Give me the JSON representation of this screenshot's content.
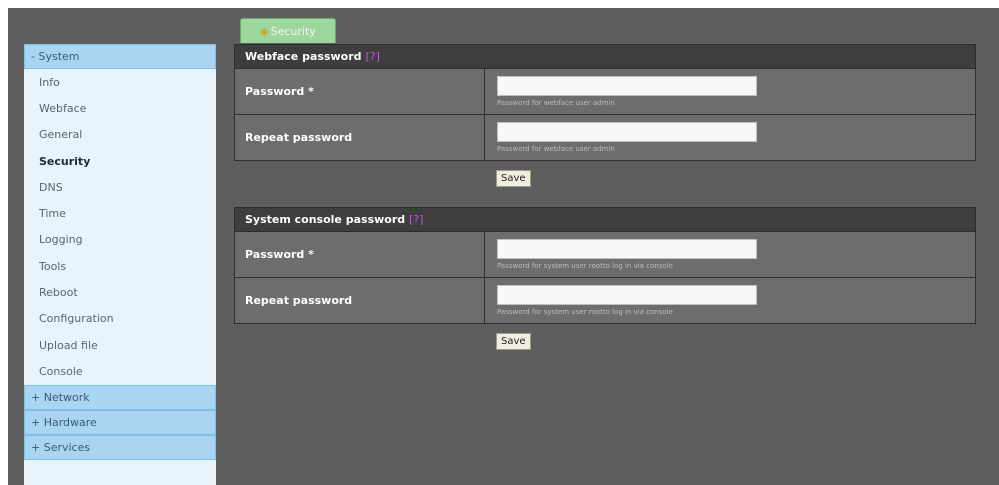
{
  "tab": {
    "label": "Security",
    "icon": "key-icon"
  },
  "sidebar": {
    "system_header": "- System",
    "items": [
      {
        "label": "Info"
      },
      {
        "label": "Webface"
      },
      {
        "label": "General"
      },
      {
        "label": "Security",
        "active": true
      },
      {
        "label": "DNS"
      },
      {
        "label": "Time"
      },
      {
        "label": "Logging"
      },
      {
        "label": "Tools"
      },
      {
        "label": "Reboot"
      },
      {
        "label": "Configuration"
      },
      {
        "label": "Upload file"
      },
      {
        "label": "Console"
      }
    ],
    "network_header": "+ Network",
    "hardware_header": "+ Hardware",
    "services_header": "+ Services"
  },
  "webface_section": {
    "title": "Webface password",
    "help": "[?]",
    "password_label": "Password *",
    "password_hint": "Password for webface user admin",
    "repeat_label": "Repeat password",
    "repeat_hint": "Password for webface user admin",
    "save_label": "Save"
  },
  "console_section": {
    "title": "System console password",
    "help": "[?]",
    "password_label": "Password *",
    "password_hint": "Password for system user rootto log in via console",
    "repeat_label": "Repeat password",
    "repeat_hint": "Password for system user rootto log in via console",
    "save_label": "Save"
  },
  "colors": {
    "background": "#5e5e5e",
    "sidebar_bg": "#e9f3fb",
    "menu_header": "#a9d5f3",
    "panel_header": "#3e3e3e",
    "tab_bg": "#9ed79e",
    "help_link": "#b95cd0"
  }
}
